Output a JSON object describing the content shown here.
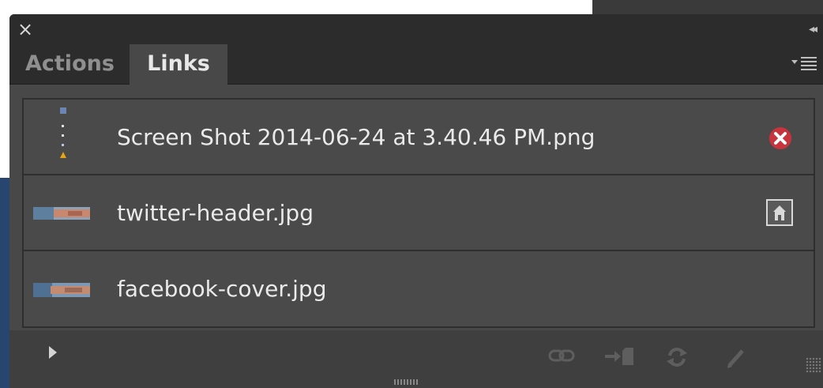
{
  "panel": {
    "close_label": "×",
    "collapse_label": "◂◂",
    "tabs": [
      {
        "label": "Actions",
        "active": false
      },
      {
        "label": "Links",
        "active": true
      }
    ],
    "menu_icon": "panel-menu-icon"
  },
  "links": [
    {
      "name": "Screen Shot 2014-06-24 at 3.40.46 PM.png",
      "status": "missing",
      "status_icon": "missing-link-icon"
    },
    {
      "name": "twitter-header.jpg",
      "status": "embedded",
      "status_icon": "embedded-icon"
    },
    {
      "name": "facebook-cover.jpg",
      "status": "ok",
      "status_icon": ""
    }
  ],
  "footer": {
    "icons": [
      "expand-arrow-icon",
      "relink-icon",
      "go-to-link-icon",
      "update-link-icon",
      "edit-original-icon"
    ]
  },
  "colors": {
    "panel_bg": "#484848",
    "header_bg": "#2c2c2c",
    "text": "#eaeaea",
    "inactive_tab": "#8f8f8f",
    "error_red": "#c8343d"
  }
}
